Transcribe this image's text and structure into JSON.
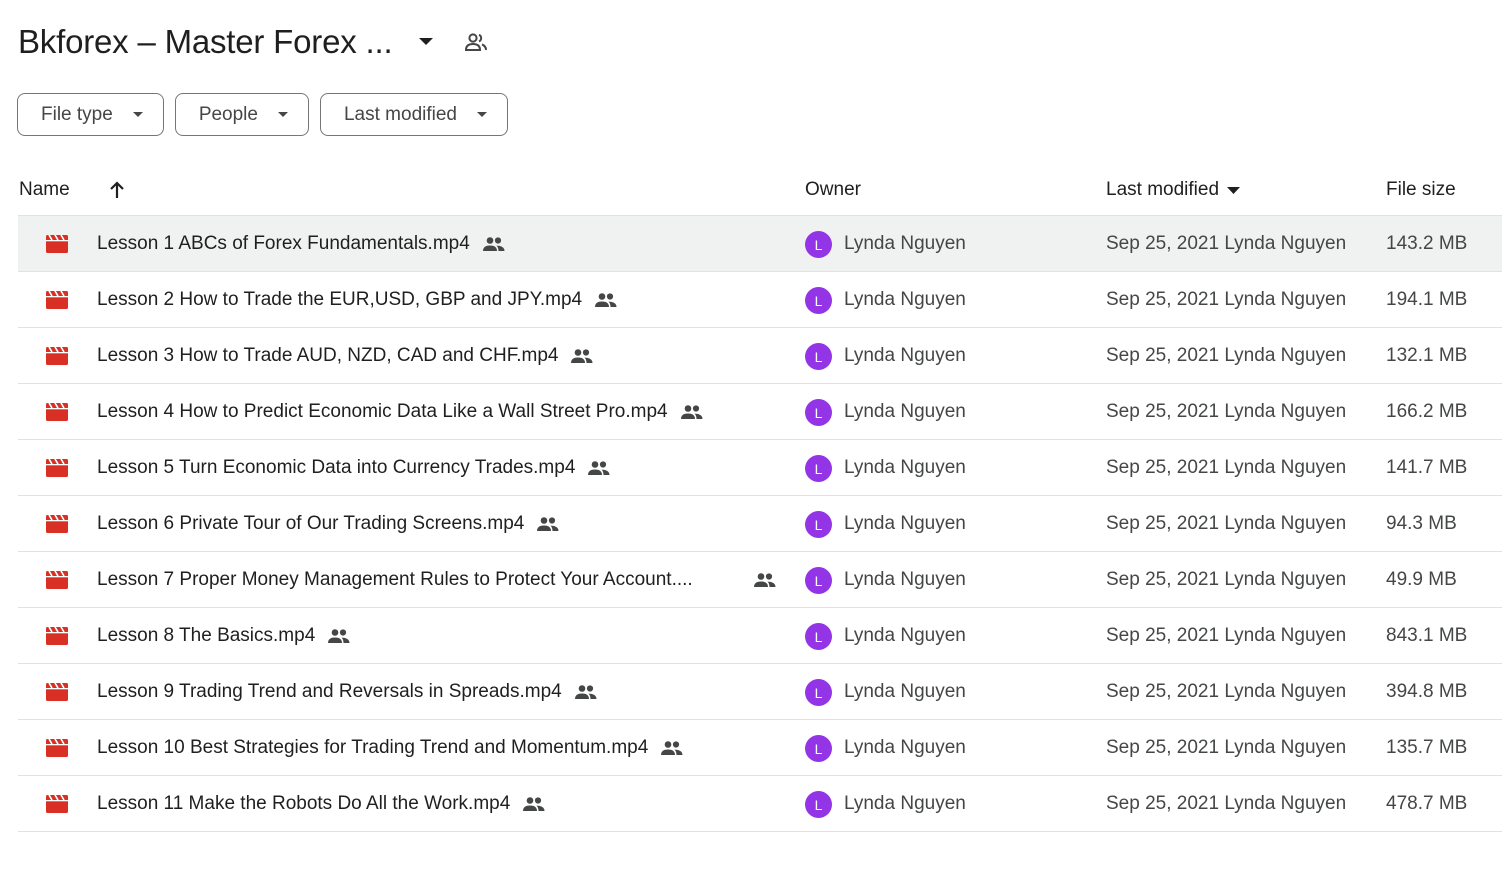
{
  "folder": {
    "title": "Bkforex – Master Forex ..."
  },
  "filters": {
    "file_type": "File type",
    "people": "People",
    "last_modified": "Last modified"
  },
  "columns": {
    "name": "Name",
    "owner": "Owner",
    "last_modified": "Last modified",
    "file_size": "File size"
  },
  "colors": {
    "video_icon": "#d93025",
    "avatar": "#9334e6",
    "selected_row": "#f0f1f1"
  },
  "icons": {
    "file": "video-file-icon",
    "shared": "people-icon",
    "sort": "arrow-up-icon",
    "dropdown": "caret-down-icon"
  },
  "files": [
    {
      "name": "Lesson 1 ABCs of Forex Fundamentals.mp4",
      "owner_initial": "L",
      "owner": "Lynda Nguyen",
      "modified": "Sep 25, 2021 Lynda Nguyen",
      "size": "143.2 MB"
    },
    {
      "name": "Lesson 2 How to Trade the EUR,USD, GBP and JPY.mp4",
      "owner_initial": "L",
      "owner": "Lynda Nguyen",
      "modified": "Sep 25, 2021 Lynda Nguyen",
      "size": "194.1 MB"
    },
    {
      "name": "Lesson 3 How to Trade AUD, NZD, CAD and CHF.mp4",
      "owner_initial": "L",
      "owner": "Lynda Nguyen",
      "modified": "Sep 25, 2021 Lynda Nguyen",
      "size": "132.1 MB"
    },
    {
      "name": "Lesson 4 How to Predict Economic Data Like a Wall Street Pro.mp4",
      "owner_initial": "L",
      "owner": "Lynda Nguyen",
      "modified": "Sep 25, 2021 Lynda Nguyen",
      "size": "166.2 MB"
    },
    {
      "name": "Lesson 5 Turn Economic Data into Currency Trades.mp4",
      "owner_initial": "L",
      "owner": "Lynda Nguyen",
      "modified": "Sep 25, 2021 Lynda Nguyen",
      "size": "141.7 MB"
    },
    {
      "name": "Lesson 6 Private Tour of Our Trading Screens.mp4",
      "owner_initial": "L",
      "owner": "Lynda Nguyen",
      "modified": "Sep 25, 2021 Lynda Nguyen",
      "size": "94.3 MB"
    },
    {
      "name": "Lesson 7 Proper Money Management Rules to Protect Your Account....",
      "owner_initial": "L",
      "owner": "Lynda Nguyen",
      "modified": "Sep 25, 2021 Lynda Nguyen",
      "size": "49.9 MB"
    },
    {
      "name": "Lesson 8 The Basics.mp4",
      "owner_initial": "L",
      "owner": "Lynda Nguyen",
      "modified": "Sep 25, 2021 Lynda Nguyen",
      "size": "843.1 MB"
    },
    {
      "name": "Lesson 9 Trading Trend and Reversals in Spreads.mp4",
      "owner_initial": "L",
      "owner": "Lynda Nguyen",
      "modified": "Sep 25, 2021 Lynda Nguyen",
      "size": "394.8 MB"
    },
    {
      "name": "Lesson 10 Best Strategies for Trading Trend and Momentum.mp4",
      "owner_initial": "L",
      "owner": "Lynda Nguyen",
      "modified": "Sep 25, 2021 Lynda Nguyen",
      "size": "135.7 MB"
    },
    {
      "name": "Lesson 11 Make the Robots Do All the Work.mp4",
      "owner_initial": "L",
      "owner": "Lynda Nguyen",
      "modified": "Sep 25, 2021 Lynda Nguyen",
      "size": "478.7 MB"
    }
  ]
}
